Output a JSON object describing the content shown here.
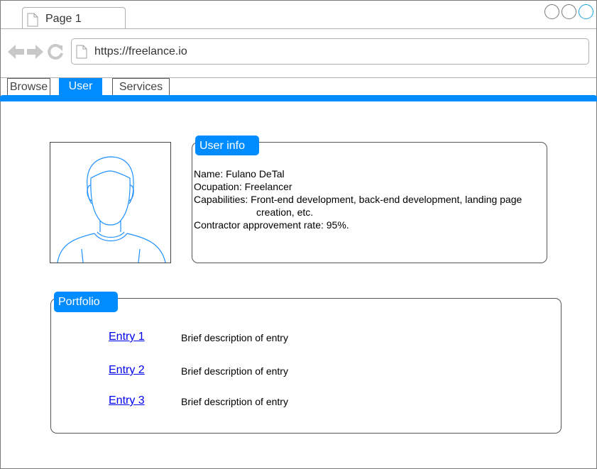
{
  "browser": {
    "tab_title": "Page 1",
    "url": "https://freelance.io"
  },
  "tabs": [
    {
      "label": "Browse",
      "selected": false
    },
    {
      "label": "User",
      "selected": true
    },
    {
      "label": "Services",
      "selected": false
    }
  ],
  "colors": {
    "accent": "#008cff",
    "link": "#0000ee"
  },
  "user_info": {
    "title": "User info",
    "name_line": "Name: Fulano DeTal",
    "occupation_line": "Ocupation: Freelancer",
    "capabilities_line": "Capabilities: Front-end development, back-end development, landing page",
    "capabilities_cont": "creation, etc.",
    "rate_line": "Contractor approvement rate: 95%."
  },
  "portfolio": {
    "title": "Portfolio",
    "entries": [
      {
        "label": "Entry 1",
        "description": "Brief description of entry"
      },
      {
        "label": "Entry 2",
        "description": "Brief description of entry"
      },
      {
        "label": "Entry 3",
        "description": "Brief description of entry"
      }
    ]
  },
  "icons": [
    "document-icon",
    "back-arrow-icon",
    "forward-arrow-icon",
    "reload-icon",
    "avatar-icon"
  ]
}
